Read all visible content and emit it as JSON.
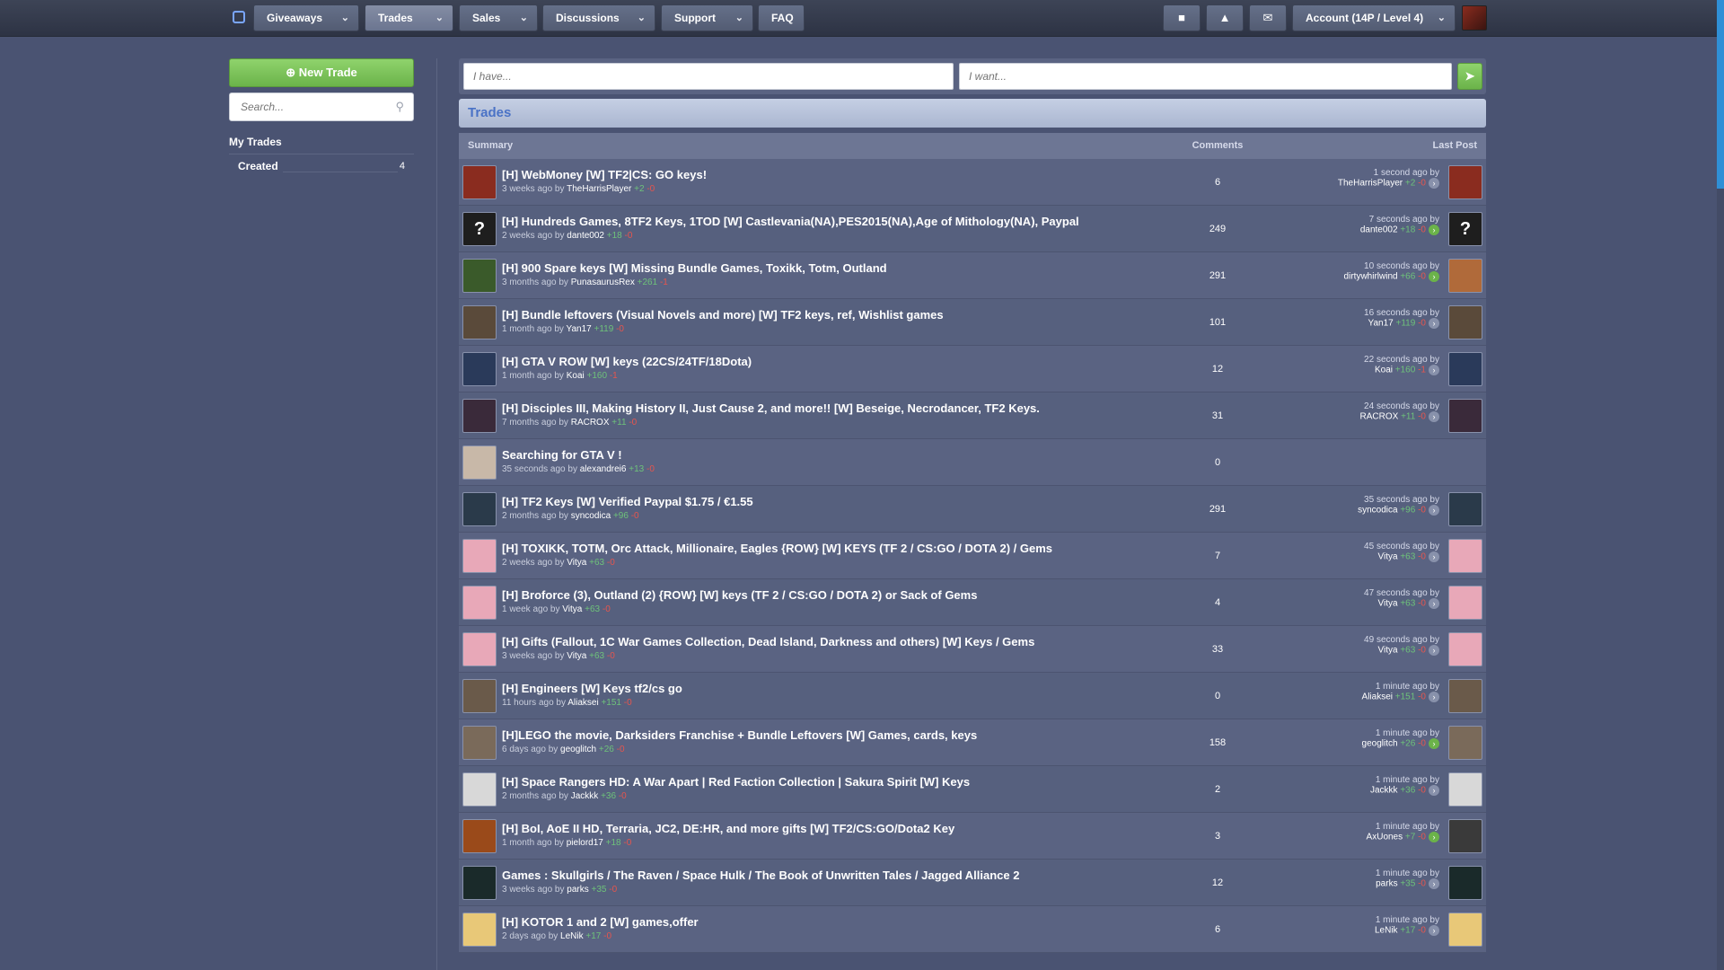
{
  "nav": {
    "items": [
      {
        "label": "Giveaways",
        "active": false
      },
      {
        "label": "Trades",
        "active": true
      },
      {
        "label": "Sales",
        "active": false
      },
      {
        "label": "Discussions",
        "active": false
      },
      {
        "label": "Support",
        "active": false
      },
      {
        "label": "FAQ",
        "active": false
      }
    ],
    "account_label": "Account (14P / Level 4)",
    "icons": [
      "gift-icon",
      "trophy-icon",
      "envelope-icon"
    ]
  },
  "sidebar": {
    "new_trade_label": "New Trade",
    "search_placeholder": "Search...",
    "my_trades_heading": "My Trades",
    "created_label": "Created",
    "created_count": "4"
  },
  "filter": {
    "have_placeholder": "I have...",
    "want_placeholder": "I want..."
  },
  "trades_heading": "Trades",
  "table": {
    "headers": {
      "summary": "Summary",
      "comments": "Comments",
      "last_post": "Last Post"
    },
    "rows": [
      {
        "title": "[H] WebMoney [W] TF2|CS: GO keys!",
        "age": "3 weeks ago by",
        "author": "TheHarrisPlayer",
        "pos": "+2",
        "neg": "-0",
        "comments": "6",
        "last_time": "1 second ago by",
        "last_user": "TheHarrisPlayer",
        "last_pos": "+2",
        "last_neg": "-0",
        "av": "#8a2c1f",
        "last_av": "#8a2c1f",
        "mark": "",
        "last_mark": "",
        "dot": "x"
      },
      {
        "title": "[H] Hundreds Games, 8TF2 Keys, 1TOD [W] Castlevania(NA),PES2015(NA),Age of Mithology(NA), Paypal",
        "age": "2 weeks ago by",
        "author": "dante002",
        "pos": "+18",
        "neg": "-0",
        "comments": "249",
        "last_time": "7 seconds ago by",
        "last_user": "dante002",
        "last_pos": "+18",
        "last_neg": "-0",
        "av": "#1e1e1e",
        "last_av": "#1e1e1e",
        "mark": "?",
        "last_mark": "?",
        "dot": "g"
      },
      {
        "title": "[H] 900 Spare keys [W] Missing Bundle Games, Toxikk, Totm, Outland",
        "age": "3 months ago by",
        "author": "PunasaurusRex",
        "pos": "+261",
        "neg": "-1",
        "comments": "291",
        "last_time": "10 seconds ago by",
        "last_user": "dirtywhirlwind",
        "last_pos": "+66",
        "last_neg": "-0",
        "av": "#3a5a2a",
        "last_av": "#b06a3a",
        "mark": "",
        "last_mark": "",
        "dot": "g"
      },
      {
        "title": "[H] Bundle leftovers (Visual Novels and more) [W] TF2 keys, ref, Wishlist games",
        "age": "1 month ago by",
        "author": "Yan17",
        "pos": "+119",
        "neg": "-0",
        "comments": "101",
        "last_time": "16 seconds ago by",
        "last_user": "Yan17",
        "last_pos": "+119",
        "last_neg": "-0",
        "av": "#5a4a3a",
        "last_av": "#5a4a3a",
        "mark": "",
        "last_mark": "",
        "dot": "x"
      },
      {
        "title": "[H] GTA V ROW [W] keys (22CS/24TF/18Dota)",
        "age": "1 month ago by",
        "author": "Koai",
        "pos": "+160",
        "neg": "-1",
        "comments": "12",
        "last_time": "22 seconds ago by",
        "last_user": "Koai",
        "last_pos": "+160",
        "last_neg": "-1",
        "av": "#2a3a5a",
        "last_av": "#2a3a5a",
        "mark": "",
        "last_mark": "",
        "dot": "x"
      },
      {
        "title": "[H] Disciples III, Making History II, Just Cause 2, and more!! [W] Beseige, Necrodancer, TF2 Keys.",
        "age": "7 months ago by",
        "author": "RACROX",
        "pos": "+11",
        "neg": "-0",
        "comments": "31",
        "last_time": "24 seconds ago by",
        "last_user": "RACROX",
        "last_pos": "+11",
        "last_neg": "-0",
        "av": "#3a2a3a",
        "last_av": "#3a2a3a",
        "mark": "",
        "last_mark": "",
        "dot": "x"
      },
      {
        "title": "Searching for GTA V !",
        "age": "35 seconds ago by",
        "author": "alexandrei6",
        "pos": "+13",
        "neg": "-0",
        "comments": "0",
        "last_time": "",
        "last_user": "",
        "last_pos": "",
        "last_neg": "",
        "av": "#c8b8a8",
        "last_av": "",
        "mark": "",
        "last_mark": "",
        "dot": ""
      },
      {
        "title": "[H] TF2 Keys [W] Verified Paypal $1.75 / €1.55",
        "age": "2 months ago by",
        "author": "syncodica",
        "pos": "+96",
        "neg": "-0",
        "comments": "291",
        "last_time": "35 seconds ago by",
        "last_user": "syncodica",
        "last_pos": "+96",
        "last_neg": "-0",
        "av": "#2a3a4a",
        "last_av": "#2a3a4a",
        "mark": "",
        "last_mark": "",
        "dot": "x"
      },
      {
        "title": "[H] TOXIKK, TOTM, Orc Attack, Millionaire, Eagles {ROW} [W] KEYS (TF 2 / CS:GO / DOTA 2) / Gems",
        "age": "2 weeks ago by",
        "author": "Vitya",
        "pos": "+63",
        "neg": "-0",
        "comments": "7",
        "last_time": "45 seconds ago by",
        "last_user": "Vitya",
        "last_pos": "+63",
        "last_neg": "-0",
        "av": "#e8a8b8",
        "last_av": "#e8a8b8",
        "mark": "",
        "last_mark": "",
        "dot": "x"
      },
      {
        "title": "[H] Broforce (3), Outland (2) {ROW} [W] keys (TF 2 / CS:GO / DOTA 2) or Sack of Gems",
        "age": "1 week ago by",
        "author": "Vitya",
        "pos": "+63",
        "neg": "-0",
        "comments": "4",
        "last_time": "47 seconds ago by",
        "last_user": "Vitya",
        "last_pos": "+63",
        "last_neg": "-0",
        "av": "#e8a8b8",
        "last_av": "#e8a8b8",
        "mark": "",
        "last_mark": "",
        "dot": "x"
      },
      {
        "title": "[H] Gifts (Fallout, 1C War Games Collection, Dead Island, Darkness and others) [W] Keys / Gems",
        "age": "3 weeks ago by",
        "author": "Vitya",
        "pos": "+63",
        "neg": "-0",
        "comments": "33",
        "last_time": "49 seconds ago by",
        "last_user": "Vitya",
        "last_pos": "+63",
        "last_neg": "-0",
        "av": "#e8a8b8",
        "last_av": "#e8a8b8",
        "mark": "",
        "last_mark": "",
        "dot": "x"
      },
      {
        "title": "[H] Engineers [W] Keys tf2/cs go",
        "age": "11 hours ago by",
        "author": "Aliaksei",
        "pos": "+151",
        "neg": "-0",
        "comments": "0",
        "last_time": "1 minute ago by",
        "last_user": "Aliaksei",
        "last_pos": "+151",
        "last_neg": "-0",
        "av": "#6a5a4a",
        "last_av": "#6a5a4a",
        "mark": "",
        "last_mark": "",
        "dot": "x"
      },
      {
        "title": "[H]LEGO the movie, Darksiders Franchise + Bundle Leftovers [W] Games, cards, keys",
        "age": "6 days ago by",
        "author": "geoglitch",
        "pos": "+26",
        "neg": "-0",
        "comments": "158",
        "last_time": "1 minute ago by",
        "last_user": "geoglitch",
        "last_pos": "+26",
        "last_neg": "-0",
        "av": "#7a6a5a",
        "last_av": "#7a6a5a",
        "mark": "",
        "last_mark": "",
        "dot": "g"
      },
      {
        "title": "[H] Space Rangers HD: A War Apart | Red Faction Collection | Sakura Spirit [W] Keys",
        "age": "2 months ago by",
        "author": "Jackkk",
        "pos": "+36",
        "neg": "-0",
        "comments": "2",
        "last_time": "1 minute ago by",
        "last_user": "Jackkk",
        "last_pos": "+36",
        "last_neg": "-0",
        "av": "#d8d8d8",
        "last_av": "#d8d8d8",
        "mark": "",
        "last_mark": "",
        "dot": "x"
      },
      {
        "title": "[H] BoI, AoE II HD, Terraria, JC2, DE:HR, and more gifts [W] TF2/CS:GO/Dota2 Key",
        "age": "1 month ago by",
        "author": "pielord17",
        "pos": "+18",
        "neg": "-0",
        "comments": "3",
        "last_time": "1 minute ago by",
        "last_user": "AxUones",
        "last_pos": "+7",
        "last_neg": "-0",
        "av": "#9a4a1a",
        "last_av": "#3a3a3a",
        "mark": "",
        "last_mark": "",
        "dot": "g"
      },
      {
        "title": "Games : Skullgirls / The Raven / Space Hulk / The Book of Unwritten Tales / Jagged Alliance 2",
        "age": "3 weeks ago by",
        "author": "parks",
        "pos": "+35",
        "neg": "-0",
        "comments": "12",
        "last_time": "1 minute ago by",
        "last_user": "parks",
        "last_pos": "+35",
        "last_neg": "-0",
        "av": "#1a2a2a",
        "last_av": "#1a2a2a",
        "mark": "",
        "last_mark": "",
        "dot": "x"
      },
      {
        "title": "[H] KOTOR 1 and 2 [W] games,offer",
        "age": "2 days ago by",
        "author": "LeNik",
        "pos": "+17",
        "neg": "-0",
        "comments": "6",
        "last_time": "1 minute ago by",
        "last_user": "LeNik",
        "last_pos": "+17",
        "last_neg": "-0",
        "av": "#e8c878",
        "last_av": "#e8c878",
        "mark": "",
        "last_mark": "",
        "dot": "x"
      }
    ]
  }
}
